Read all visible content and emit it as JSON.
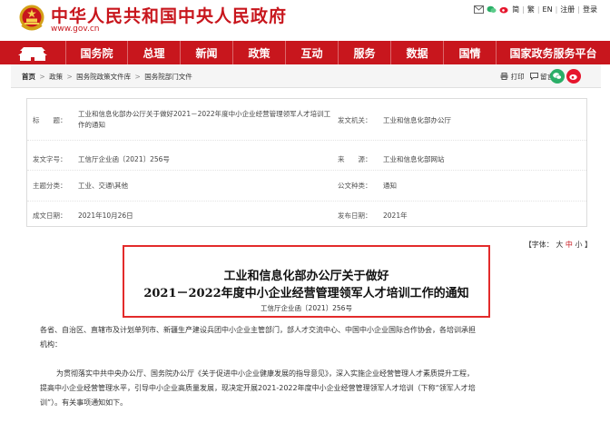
{
  "header": {
    "site_title": "中华人民共和国中央人民政府",
    "site_url": "www.gov.cn",
    "top_links": [
      "简",
      "繁",
      "EN",
      "注册",
      "登录"
    ]
  },
  "nav": {
    "items": [
      "国务院",
      "总理",
      "新闻",
      "政策",
      "互动",
      "服务",
      "数据",
      "国情",
      "国家政务服务平台"
    ]
  },
  "breadcrumb": {
    "items": [
      "首页",
      "政策",
      "国务院政策文件库",
      "国务院部门文件"
    ],
    "tools": [
      "打印",
      "留言"
    ]
  },
  "meta": {
    "title_label": "标　　题：",
    "title_value": "工业和信息化部办公厅关于做好2021－2022年度中小企业经营管理领军人才培训工作的通知",
    "issuer_label": "发文机关：",
    "issuer_value": "工业和信息化部办公厅",
    "docno_label": "发文字号：",
    "docno_value": "工信厅企业函〔2021〕256号",
    "source_label": "来　　源：",
    "source_value": "工业和信息化部网站",
    "category_label": "主题分类：",
    "category_value": "工业、交通\\其他",
    "type_label": "公文种类：",
    "type_value": "通知",
    "written_label": "成文日期：",
    "written_value": "2021年10月26日",
    "published_label": "发布日期：",
    "published_value": "2021年"
  },
  "font_control": {
    "label": "【字体：",
    "large": "大",
    "medium": "中",
    "small": "小",
    "close": "】"
  },
  "article": {
    "title_line1": "工业和信息化部办公厅关于做好",
    "title_line2": "2021－2022年度中小企业经营管理领军人才培训工作的通知",
    "doc_no": "工信厅企业函〔2021〕256号",
    "para1_line1": "各省、自治区、直辖市及计划单列市、新疆生产建设兵团中小企业主管部门，部人才交流中心、中国中小企业国际合作协会，各培训承担",
    "para1_line2": "机构：",
    "para2_line1": "为贯彻落实中共中央办公厅、国务院办公厅《关于促进中小企业健康发展的指导意见》，深入实施企业经营管理人才素质提升工程，",
    "para2_line2": "提高中小企业经营管理水平，引导中小企业高质量发展，现决定开展2021-2022年度中小企业经营管理领军人才培训（下称“领军人才培",
    "para2_line3": "训”）。有关事项通知如下。"
  },
  "colors": {
    "brand_red": "#c8161d",
    "title_box_border": "#e32b2b",
    "wechat_green": "#2aae67",
    "weibo_red": "#e6162d"
  }
}
